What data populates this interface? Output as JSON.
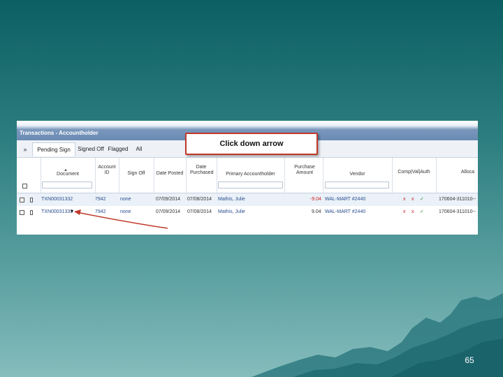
{
  "slide": {
    "number": "65"
  },
  "window": {
    "title": "Transactions - Accountholder"
  },
  "tabs": {
    "collapse_label": "»",
    "items": [
      "Pending Sign Off",
      "Signed Off",
      "Flagged",
      "All"
    ],
    "active": "Pending Sign Off"
  },
  "columns": {
    "document": "Document",
    "account_id": "Account ID",
    "sign_off": "Sign Off",
    "date_posted": "Date Posted",
    "date_purchased": "Date Purchased",
    "primary_accountholder": "Primary Accountholder",
    "purchase_amount": "Purchase Amount",
    "vendor": "Vendor",
    "comp_val_auth": "Comp|Val|Auth",
    "alloc": "Alloca"
  },
  "rows": [
    {
      "document": "TXN00031332",
      "account_id": "7942",
      "sign_off": "none",
      "date_posted": "07/09/2014",
      "date_purchased": "07/08/2014",
      "accountholder": "Mathis, Julie",
      "amount": "-9.04",
      "vendor": "WAL-MART #2440",
      "flags": [
        "x",
        "x",
        "✓"
      ],
      "alloc": "170604-311010--"
    },
    {
      "document": "TXN00031333",
      "dropdown": "▾",
      "account_id": "7942",
      "sign_off": "none",
      "date_posted": "07/09/2014",
      "date_purchased": "07/08/2014",
      "accountholder": "Mathis, Julie",
      "amount": "9.04",
      "vendor": "WAL-MART #2440",
      "flags": [
        "x",
        "x",
        "✓"
      ],
      "alloc": "170604-311010--"
    }
  ],
  "callout": {
    "text": "Click down arrow",
    "border_color": "#c0392b"
  },
  "colors": {
    "background_top": "#0c5f62",
    "background_bottom": "#86bcbc",
    "link": "#2b4f8f",
    "accent_red": "#cc2222"
  }
}
